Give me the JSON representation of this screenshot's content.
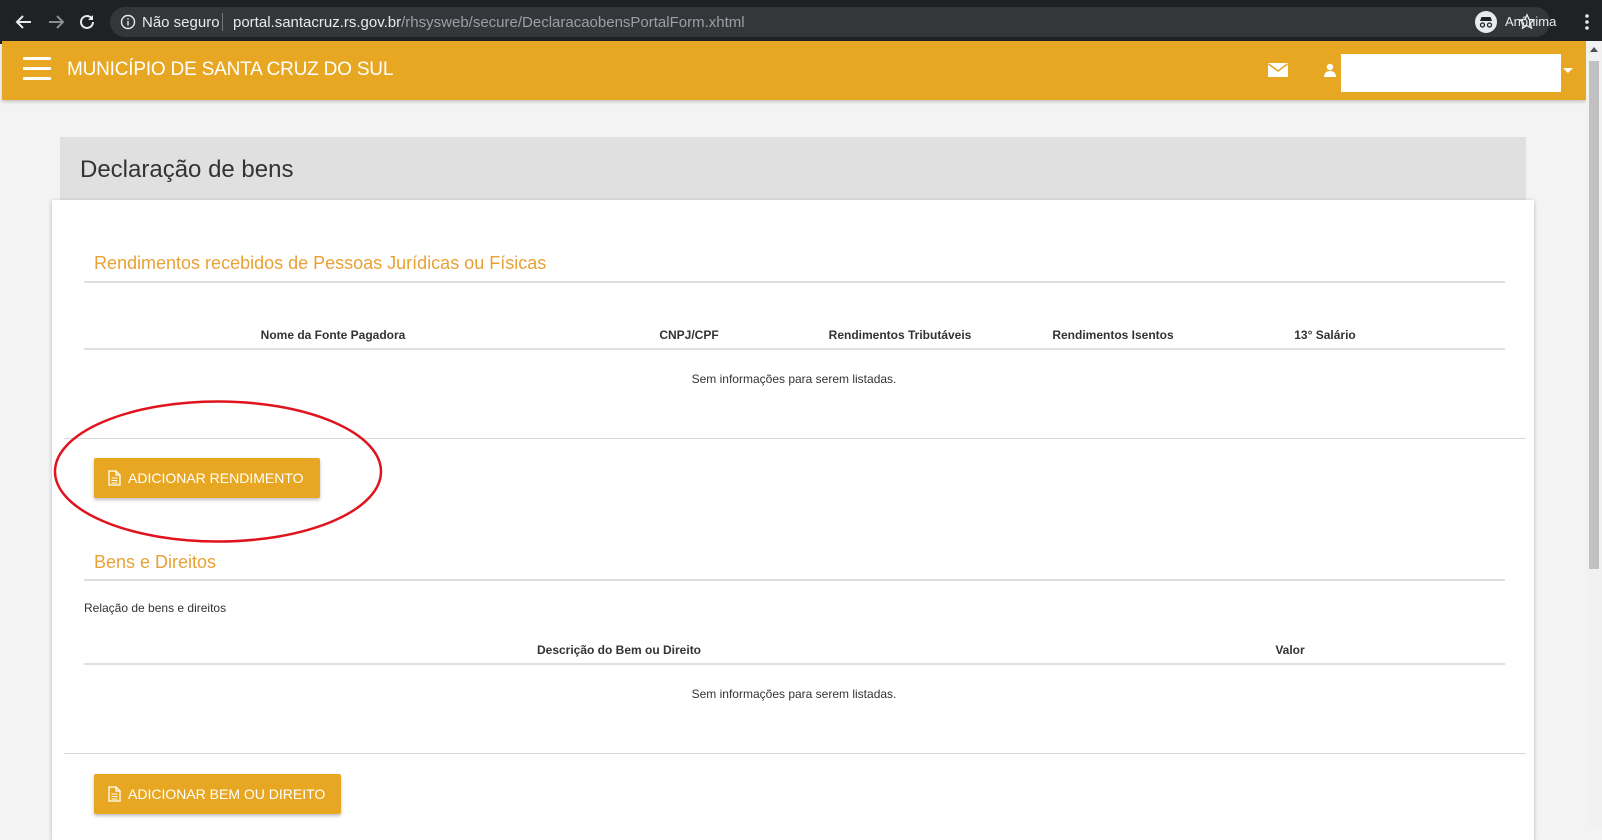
{
  "browser": {
    "security_label": "Não seguro",
    "url_host": "portal.santacruz.rs.gov.br",
    "url_path": "/rhsysweb/secure/DeclaracaobensPortalForm.xhtml",
    "profile_label": "Anônima",
    "icons": [
      "back-icon",
      "forward-icon",
      "reload-icon",
      "info-icon",
      "star-icon",
      "incognito-icon",
      "kebab-menu-icon"
    ]
  },
  "header": {
    "title": "MUNICÍPIO DE SANTA CRUZ DO SUL",
    "icons": [
      "hamburger-menu-icon",
      "mail-icon",
      "user-icon",
      "caret-down-icon"
    ],
    "accent_color": "#e8a722"
  },
  "page": {
    "title": "Declaração de bens"
  },
  "rendimentos": {
    "section_title": "Rendimentos recebidos de Pessoas Jurídicas ou Físicas",
    "columns": [
      "Nome da Fonte Pagadora",
      "CNPJ/CPF",
      "Rendimentos Tributáveis",
      "Rendimentos Isentos",
      "13° Salário"
    ],
    "empty_message": "Sem informações para serem listadas.",
    "add_button": "ADICIONAR RENDIMENTO"
  },
  "bens": {
    "section_title": "Bens e Direitos",
    "caption": "Relação de bens e direitos",
    "columns": [
      "Descrição do Bem ou Direito",
      "Valor"
    ],
    "empty_message": "Sem informações para serem listadas.",
    "add_button": "ADICIONAR BEM OU DIREITO"
  },
  "annotation_color": "#e0141e"
}
